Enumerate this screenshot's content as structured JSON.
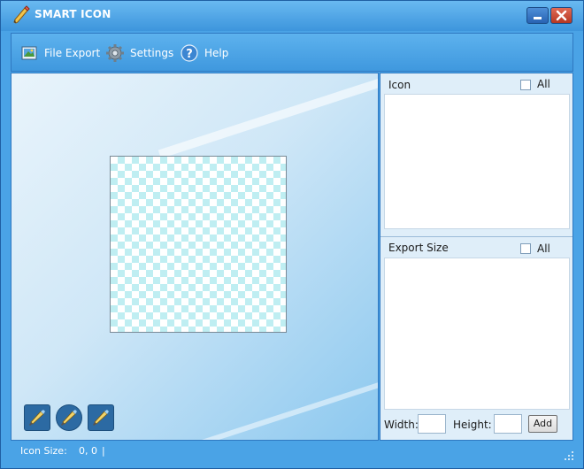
{
  "window": {
    "title": "SMART ICON"
  },
  "toolbar": {
    "file_export": "File Export",
    "settings": "Settings",
    "help": "Help"
  },
  "icon_panel": {
    "label": "Icon",
    "all_label": "All"
  },
  "export_panel": {
    "label": "Export Size",
    "all_label": "All"
  },
  "size_form": {
    "width_label": "Width:",
    "height_label": "Height:",
    "width_value": "",
    "height_value": "",
    "add_label": "Add"
  },
  "status": {
    "icon_size_label": "Icon Size:",
    "icon_size_value": "0, 0",
    "divider": "|"
  },
  "colors": {
    "title_bar": "#4ea8ea",
    "accent": "#2f78c1",
    "checker": "#bfeef2"
  },
  "icons": [
    "pencil-icon",
    "image-export-icon",
    "gear-icon",
    "help-icon",
    "minimize-icon",
    "close-icon",
    "brush-icon"
  ]
}
